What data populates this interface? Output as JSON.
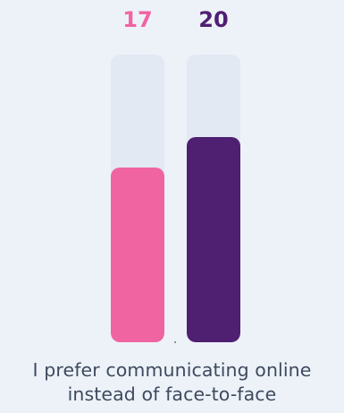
{
  "chart_data": {
    "type": "bar",
    "categories": [
      "",
      ""
    ],
    "values": [
      17,
      20
    ],
    "ylim": [
      0,
      28
    ],
    "colors": [
      "#f064a2",
      "#4f1f72"
    ],
    "track_color": "#e2e9f3",
    "caption": "I prefer communicating online instead of face-to-face"
  },
  "question": {
    "line1": "I prefer communicating online",
    "line2": "instead of face-to-face"
  },
  "values_text": [
    "17",
    "20"
  ]
}
